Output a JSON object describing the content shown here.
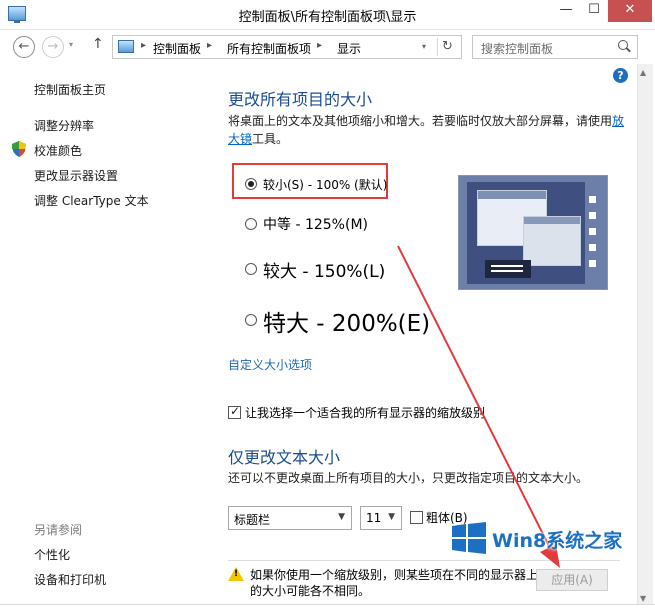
{
  "window": {
    "title": "控制面板\\所有控制面板项\\显示",
    "controls": {
      "minimize": "—",
      "maximize": "☐",
      "close": "✕"
    }
  },
  "nav": {
    "back": "←",
    "forward": "→",
    "recent": "▾",
    "up": "↑",
    "breadcrumb": [
      "控制面板",
      "所有控制面板项",
      "显示"
    ],
    "crumb_sep": "▸",
    "dropdown": "▾",
    "refresh": "↻",
    "search_placeholder": "搜索控制面板"
  },
  "help": "?",
  "sidebar": {
    "items": [
      {
        "label": "控制面板主页"
      },
      {
        "label": "调整分辨率"
      },
      {
        "label": "校准颜色"
      },
      {
        "label": "更改显示器设置"
      },
      {
        "label": "调整 ClearType 文本"
      }
    ],
    "see_also_heading": "另请参阅",
    "see_also": [
      {
        "label": "个性化"
      },
      {
        "label": "设备和打印机"
      }
    ]
  },
  "main": {
    "heading": "更改所有项目的大小",
    "description_pre": "将桌面上的文本及其他项缩小和增大。若要临时仅放大部分屏幕，请使用",
    "description_link": "放大镜",
    "description_post": "工具。",
    "options": [
      {
        "label": "较小(S) - 100% (默认)",
        "checked": true
      },
      {
        "label": "中等 - 125%(M)",
        "checked": false
      },
      {
        "label": "较大 - 150%(L)",
        "checked": false
      },
      {
        "label": "特大 - 200%(E)",
        "checked": false
      }
    ],
    "custom_link": "自定义大小选项",
    "scaling_checkbox": {
      "label": "让我选择一个适合我的所有显示器的缩放级别",
      "checked": true
    },
    "text_heading": "仅更改文本大小",
    "text_description": "还可以不更改桌面上所有项目的大小，只更改指定项目的文本大小。",
    "item_select": "标题栏",
    "size_select": "11",
    "bold_checkbox": {
      "label": "粗体(B)",
      "checked": false
    },
    "warning": "如果你使用一个缩放级别，则某些项在不同的显示器上的大小可能各不相同。",
    "apply_button": "应用(A)"
  },
  "watermark": {
    "text": "Win8系统之家"
  },
  "colors": {
    "heading": "#1a4d8f",
    "link": "#1a6bb5",
    "highlight": "#e23b3b",
    "close_button": "#c75050"
  }
}
